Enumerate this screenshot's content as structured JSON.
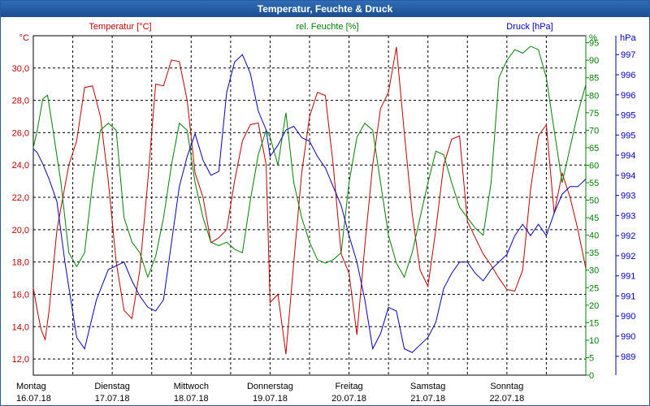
{
  "window": {
    "title": "Temperatur, Feuchte & Druck"
  },
  "colors": {
    "temperature": "#c00000",
    "humidity": "#008000",
    "pressure": "#0000c0",
    "grid": "#000000",
    "titlebar": "#1f5aa6"
  },
  "chart_data": {
    "type": "line",
    "title": "Temperatur, Feuchte & Druck",
    "grid": true,
    "x_range": [
      0,
      7
    ],
    "x_ticks": [
      {
        "day": "Montag",
        "date": "16.07.18"
      },
      {
        "day": "Dienstag",
        "date": "17.07.18"
      },
      {
        "day": "Mittwoch",
        "date": "18.07.18"
      },
      {
        "day": "Donnerstag",
        "date": "19.07.18"
      },
      {
        "day": "Freitag",
        "date": "20.07.18"
      },
      {
        "day": "Samstag",
        "date": "21.07.18"
      },
      {
        "day": "Sonntag",
        "date": "22.07.18"
      }
    ],
    "axes": {
      "temperature": {
        "label": "Temperatur [°C]",
        "unit": "°C",
        "range": [
          11,
          32
        ],
        "ticks": [
          "12,0",
          "14,0",
          "16,0",
          "18,0",
          "20,0",
          "22,0",
          "24,0",
          "26,0",
          "28,0",
          "30,0"
        ]
      },
      "humidity": {
        "label": "rel. Feuchte [%]",
        "unit": "%",
        "range": [
          0,
          97
        ],
        "ticks": [
          "0",
          "5",
          "10",
          "15",
          "20",
          "25",
          "30",
          "35",
          "40",
          "45",
          "50",
          "55",
          "60",
          "65",
          "70",
          "75",
          "80",
          "85",
          "90",
          "95"
        ]
      },
      "pressure": {
        "label": "Druck [hPa]",
        "unit": "hPa",
        "range": [
          988.5,
          997.5
        ],
        "ticks": [
          "989",
          "990",
          "990",
          "991",
          "991",
          "992",
          "992",
          "993",
          "993",
          "994",
          "994",
          "995",
          "995",
          "996",
          "996",
          "997"
        ]
      }
    },
    "series": [
      {
        "name": "Temperatur [°C]",
        "axis": "temperature",
        "x": [
          0,
          0.05,
          0.1,
          0.15,
          0.2,
          0.3,
          0.45,
          0.55,
          0.65,
          0.75,
          0.85,
          0.95,
          1.05,
          1.15,
          1.25,
          1.35,
          1.45,
          1.55,
          1.65,
          1.75,
          1.85,
          1.95,
          2.05,
          2.15,
          2.25,
          2.35,
          2.45,
          2.55,
          2.65,
          2.75,
          2.85,
          2.95,
          3.0,
          3.1,
          3.2,
          3.3,
          3.4,
          3.5,
          3.6,
          3.7,
          3.8,
          3.9,
          4.0,
          4.1,
          4.2,
          4.3,
          4.4,
          4.5,
          4.6,
          4.7,
          4.8,
          4.9,
          5.0,
          5.1,
          5.2,
          5.3,
          5.4,
          5.5,
          5.6,
          5.7,
          5.8,
          5.9,
          6.0,
          6.1,
          6.2,
          6.3,
          6.4,
          6.5,
          6.6,
          6.7,
          6.8,
          6.9,
          7.0
        ],
        "values": [
          16.4,
          15,
          13.8,
          13.2,
          15,
          20,
          24,
          25.5,
          28.8,
          28.9,
          27,
          23,
          18,
          15,
          14.5,
          17.5,
          23,
          29,
          28.9,
          30.5,
          30.4,
          28,
          23.5,
          22,
          19.2,
          19.5,
          20,
          23,
          25.5,
          26.5,
          26.6,
          24,
          15.5,
          16,
          12.3,
          18,
          23.5,
          27,
          28.5,
          28.3,
          24,
          18.5,
          17.3,
          13.5,
          19,
          24,
          27.5,
          28.5,
          31.3,
          26,
          21,
          17.5,
          16.5,
          20,
          24,
          25.6,
          25.8,
          20.5,
          19.5,
          18.5,
          17.8,
          17,
          16.3,
          16.2,
          17.5,
          22.5,
          25.8,
          26.5,
          21,
          23.5,
          22,
          20,
          17.6
        ]
      },
      {
        "name": "rel. Feuchte [%]",
        "axis": "humidity",
        "x": [
          0,
          0.05,
          0.12,
          0.18,
          0.25,
          0.35,
          0.45,
          0.55,
          0.65,
          0.75,
          0.85,
          0.95,
          1.05,
          1.15,
          1.25,
          1.35,
          1.45,
          1.55,
          1.65,
          1.75,
          1.85,
          1.95,
          2.05,
          2.15,
          2.25,
          2.35,
          2.45,
          2.55,
          2.65,
          2.75,
          2.85,
          2.95,
          3.0,
          3.1,
          3.2,
          3.3,
          3.4,
          3.5,
          3.6,
          3.7,
          3.8,
          3.9,
          4.0,
          4.1,
          4.2,
          4.3,
          4.4,
          4.5,
          4.6,
          4.7,
          4.8,
          4.9,
          5.0,
          5.1,
          5.2,
          5.3,
          5.4,
          5.5,
          5.6,
          5.7,
          5.8,
          5.9,
          6.0,
          6.1,
          6.2,
          6.3,
          6.4,
          6.5,
          6.6,
          6.7,
          6.8,
          6.9,
          7.0
        ],
        "values": [
          65,
          70,
          79,
          80,
          70,
          55,
          35,
          31,
          35,
          55,
          70,
          72,
          70,
          45,
          38,
          35,
          28,
          34,
          45,
          60,
          72,
          70,
          55,
          45,
          38,
          37,
          38,
          36,
          35,
          50,
          63,
          70,
          68,
          60,
          75,
          55,
          45,
          38,
          33,
          32,
          33,
          35,
          55,
          68,
          72,
          70,
          55,
          40,
          32,
          28,
          35,
          45,
          55,
          64,
          63,
          55,
          48,
          45,
          42,
          40,
          55,
          85,
          90,
          93,
          92,
          94,
          93,
          85,
          70,
          55,
          65,
          75,
          83
        ]
      },
      {
        "name": "Druck [hPa]",
        "axis": "pressure",
        "x": [
          0,
          0.05,
          0.12,
          0.2,
          0.3,
          0.4,
          0.55,
          0.65,
          0.8,
          0.95,
          1.05,
          1.15,
          1.25,
          1.35,
          1.45,
          1.55,
          1.65,
          1.75,
          1.85,
          1.95,
          2.05,
          2.15,
          2.25,
          2.35,
          2.45,
          2.55,
          2.65,
          2.75,
          2.85,
          2.95,
          3.0,
          3.1,
          3.2,
          3.3,
          3.4,
          3.5,
          3.6,
          3.7,
          3.8,
          3.9,
          4.0,
          4.1,
          4.2,
          4.3,
          4.4,
          4.5,
          4.6,
          4.7,
          4.8,
          4.9,
          5.0,
          5.1,
          5.2,
          5.3,
          5.4,
          5.5,
          5.6,
          5.7,
          5.8,
          5.9,
          6.0,
          6.1,
          6.2,
          6.3,
          6.4,
          6.5,
          6.6,
          6.7,
          6.8,
          6.9,
          7.0
        ],
        "values": [
          994.5,
          994.4,
          994.1,
          993.7,
          993.1,
          991.5,
          989.5,
          989.2,
          990.5,
          991.3,
          991.4,
          991.5,
          991.0,
          990.6,
          990.3,
          990.2,
          990.5,
          992.0,
          993.5,
          994.3,
          994.9,
          994.2,
          993.8,
          993.9,
          996.0,
          996.8,
          997.0,
          996.5,
          995.5,
          995.0,
          994.3,
          994.6,
          995.0,
          995.1,
          994.8,
          994.7,
          994.3,
          994.0,
          993.5,
          993.0,
          992.2,
          991.5,
          990.5,
          989.2,
          989.6,
          990.3,
          990.2,
          989.2,
          989.1,
          989.3,
          989.5,
          989.9,
          990.8,
          991.2,
          991.5,
          991.5,
          991.2,
          991.0,
          991.3,
          991.5,
          991.7,
          992.2,
          992.5,
          992.2,
          992.5,
          992.2,
          992.8,
          993.3,
          993.5,
          993.5,
          993.7
        ]
      }
    ]
  }
}
